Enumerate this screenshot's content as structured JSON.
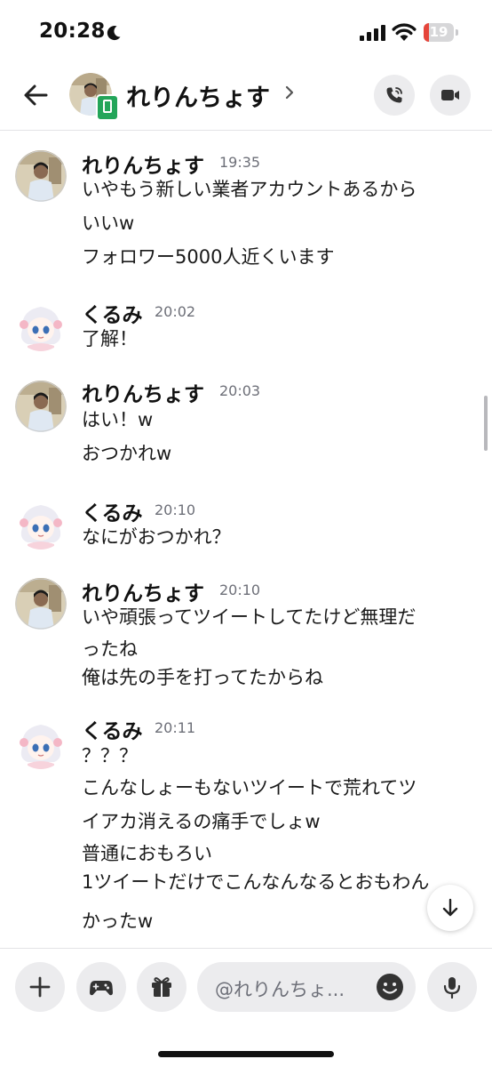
{
  "status_bar": {
    "time": "20:28",
    "battery_level": "19",
    "battery_fraction": 0.19,
    "icons": [
      "moon-icon",
      "signal-icon",
      "wifi-icon",
      "battery-icon"
    ]
  },
  "header": {
    "name": "れりんちょす",
    "icons": [
      "back-arrow-icon",
      "mobile-status-icon",
      "chevron-right-icon",
      "voice-call-icon",
      "video-call-icon"
    ]
  },
  "messages": [
    {
      "author": "れりんちょす",
      "time": "19:35",
      "avatar": "photo-avatar",
      "lines": [
        "いやもう新しい業者アカウントあるから",
        "いいw",
        "フォロワー5000人近くいます"
      ]
    },
    {
      "author": "くるみ",
      "time": "20:02",
      "avatar": "anime-avatar",
      "lines": [
        "了解！"
      ]
    },
    {
      "author": "れりんちょす",
      "time": "20:03",
      "avatar": "photo-avatar",
      "lines": [
        "はい！w",
        "おつかれw"
      ]
    },
    {
      "author": "くるみ",
      "time": "20:10",
      "avatar": "anime-avatar",
      "lines": [
        "なにがおつかれ？"
      ]
    },
    {
      "author": "れりんちょす",
      "time": "20:10",
      "avatar": "photo-avatar",
      "lines": [
        "いや頑張ってツイートしてたけど無理だ",
        "ったね",
        "俺は先の手を打ってたからね"
      ]
    },
    {
      "author": "くるみ",
      "time": "20:11",
      "avatar": "anime-avatar",
      "lines": [
        "？？？",
        "こんなしょーもないツイートで荒れてツ",
        "イアカ消えるの痛手でしょw",
        "普通におもろい",
        "1ツイートだけでこんなんなるとおもわん",
        "かったw"
      ]
    }
  ],
  "input_bar": {
    "placeholder": "@れりんちょ...",
    "icons": [
      "plus-icon",
      "gamepad-icon",
      "gift-icon",
      "emoji-icon",
      "microphone-icon"
    ]
  },
  "jump_to_latest": {
    "icon": "arrow-down-icon"
  },
  "colors": {
    "text": "#111111",
    "secondary_text": "#6d6f78",
    "button_bg": "#ececee",
    "online_badge": "#23a559",
    "battery_low": "#e5453b"
  }
}
